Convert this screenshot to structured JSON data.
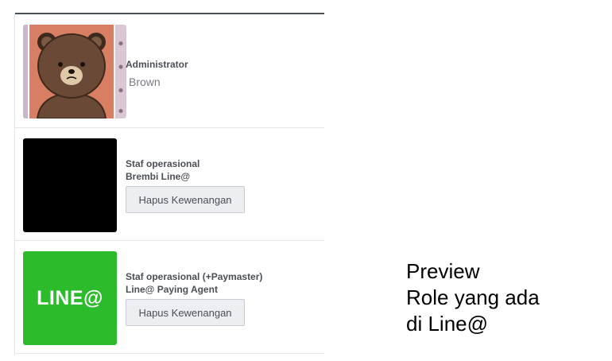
{
  "roles": [
    {
      "role": "Administrator",
      "name": "Brown",
      "avatar": "brown-bear-avatar-icon"
    },
    {
      "role": "Staf operasional",
      "name": "Brembi Line@",
      "button_label": "Hapus Kewenangan",
      "avatar": "black-avatar"
    },
    {
      "role": "Staf operasional (+Paymaster)",
      "name": "Line@ Paying Agent",
      "button_label": "Hapus Kewenangan",
      "avatar_text": "LINE@",
      "avatar": "line-at-logo-icon",
      "avatar_color": "#2bbb2b"
    }
  ],
  "note": {
    "line1": "Preview",
    "line2": "Role yang ada",
    "line3": "di Line@"
  }
}
